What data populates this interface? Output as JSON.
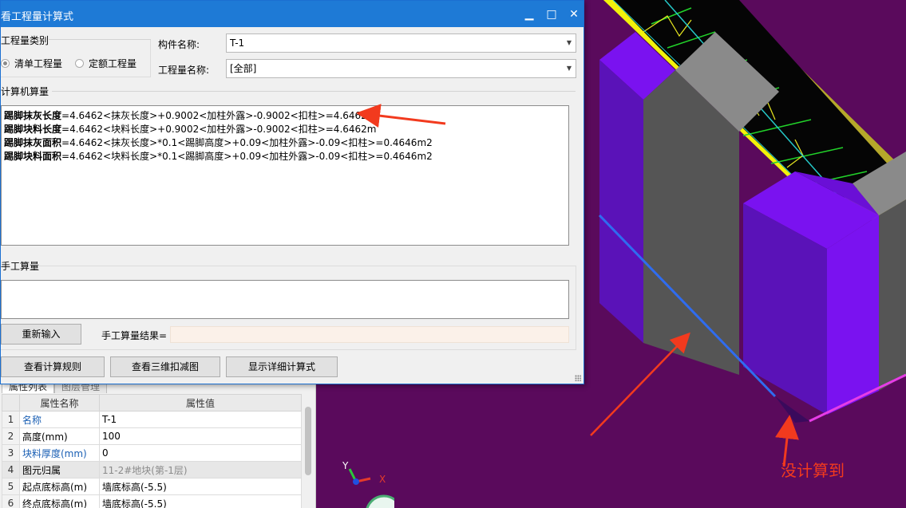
{
  "dialog": {
    "title": "看工程量计算式",
    "category_group": "工程量类别",
    "radio_list": "清单工程量",
    "radio_quota": "定额工程量",
    "component_label": "构件名称:",
    "component_value": "T-1",
    "quantity_label": "工程量名称:",
    "quantity_value": "[全部]",
    "computer_group": "计算机算量",
    "calc_lines": [
      {
        "name": "踢脚抹灰长度",
        "formula": "=4.6462<抹灰长度>+0.9002<加柱外露>-0.9002<扣柱>=4.6462m"
      },
      {
        "name": "踢脚块料长度",
        "formula": "=4.6462<块料长度>+0.9002<加柱外露>-0.9002<扣柱>=4.6462m"
      },
      {
        "name": "踢脚抹灰面积",
        "formula": "=4.6462<抹灰长度>*0.1<踢脚高度>+0.09<加柱外露>-0.09<扣柱>=0.4646m2"
      },
      {
        "name": "踢脚块料面积",
        "formula": "=4.6462<块料长度>*0.1<踢脚高度>+0.09<加柱外露>-0.09<扣柱>=0.4646m2"
      }
    ],
    "manual_group": "手工算量",
    "reenter_button": "重新输入",
    "manual_result_label": "手工算量结果=",
    "rules_button": "查看计算规则",
    "view3d_button": "查看三维扣减图",
    "detail_button": "显示详细计算式"
  },
  "window_buttons": {
    "minimize": "▁",
    "maximize": "□",
    "close": "✕"
  },
  "properties": {
    "tabs": [
      "属性列表",
      "图层管理"
    ],
    "header_name": "属性名称",
    "header_value": "属性值",
    "rows": [
      {
        "idx": "1",
        "name": "名称",
        "value": "T-1"
      },
      {
        "idx": "2",
        "name": "高度(mm)",
        "value": "100"
      },
      {
        "idx": "3",
        "name": "块料厚度(mm)",
        "value": "0"
      },
      {
        "idx": "4",
        "name": "图元归属",
        "value": "11-2#地块(第-1层)"
      },
      {
        "idx": "5",
        "name": "起点底标高(m)",
        "value": "墙底标高(-5.5)"
      },
      {
        "idx": "6",
        "name": "终点底标高(m)",
        "value": "墙底标高(-5.5)"
      }
    ]
  },
  "annotation": {
    "text": "没计算到"
  },
  "axis": {
    "x_label": "X",
    "y_label": "Y"
  },
  "colors": {
    "title_bar": "#1e7ad6",
    "viewport_bg": "#5a0a5c",
    "annotation_red": "#f23a1e",
    "column_purple": "#7a12f0",
    "wall_gray": "#8a8a8a",
    "slab_yellow": "#b5a82a",
    "blue_line": "#2f6cf0",
    "magenta_line": "#e63ce6"
  }
}
